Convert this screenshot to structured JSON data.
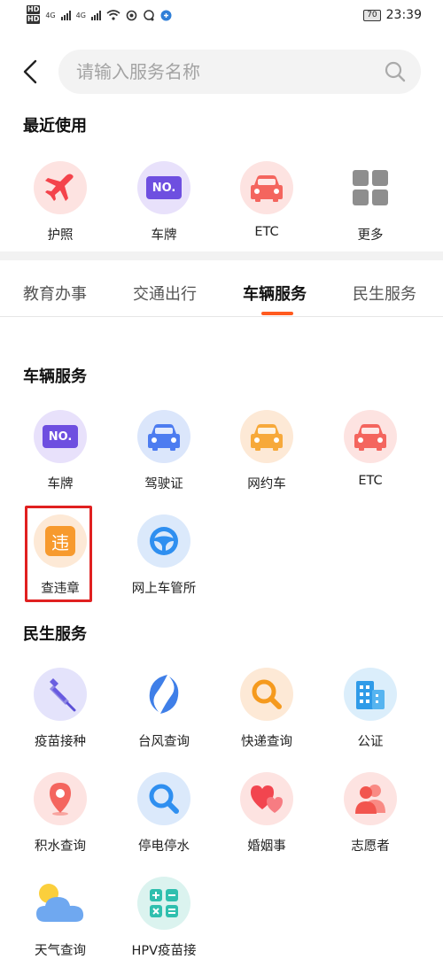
{
  "status": {
    "network1": "4G",
    "network2": "4G",
    "battery": "70",
    "time": "23:39"
  },
  "search": {
    "placeholder": "请输入服务名称"
  },
  "recent": {
    "title": "最近使用",
    "items": [
      {
        "label": "护照",
        "icon": "airplane-icon"
      },
      {
        "label": "车牌",
        "icon": "license-plate-icon",
        "badge": "NO."
      },
      {
        "label": "ETC",
        "icon": "car-icon"
      },
      {
        "label": "更多",
        "icon": "grid-icon"
      }
    ]
  },
  "tabs": [
    {
      "label": "教育办事",
      "active": false
    },
    {
      "label": "交通出行",
      "active": false
    },
    {
      "label": "车辆服务",
      "active": true
    },
    {
      "label": "民生服务",
      "active": false
    }
  ],
  "vehicle": {
    "title": "车辆服务",
    "items": [
      {
        "label": "车牌",
        "icon": "license-plate-icon",
        "badge": "NO."
      },
      {
        "label": "驾驶证",
        "icon": "car-icon"
      },
      {
        "label": "网约车",
        "icon": "car-icon"
      },
      {
        "label": "ETC",
        "icon": "car-icon"
      },
      {
        "label": "查违章",
        "icon": "violation-icon",
        "badge": "违"
      },
      {
        "label": "网上车管所",
        "icon": "steering-wheel-icon"
      }
    ]
  },
  "livelihood": {
    "title": "民生服务",
    "items": [
      {
        "label": "疫苗接种",
        "icon": "syringe-icon"
      },
      {
        "label": "台风查询",
        "icon": "typhoon-icon"
      },
      {
        "label": "快递查询",
        "icon": "magnifier-icon"
      },
      {
        "label": "公证",
        "icon": "building-icon"
      },
      {
        "label": "积水查询",
        "icon": "location-pin-icon"
      },
      {
        "label": "停电停水",
        "icon": "magnifier-icon"
      },
      {
        "label": "婚姻事",
        "icon": "hearts-icon"
      },
      {
        "label": "志愿者",
        "icon": "people-icon"
      },
      {
        "label": "天气查询",
        "icon": "weather-icon"
      },
      {
        "label": "HPV疫苗接",
        "icon": "calculator-icon"
      }
    ]
  },
  "colors": {
    "accent": "#ff5a1f",
    "highlight": "#e02020"
  }
}
